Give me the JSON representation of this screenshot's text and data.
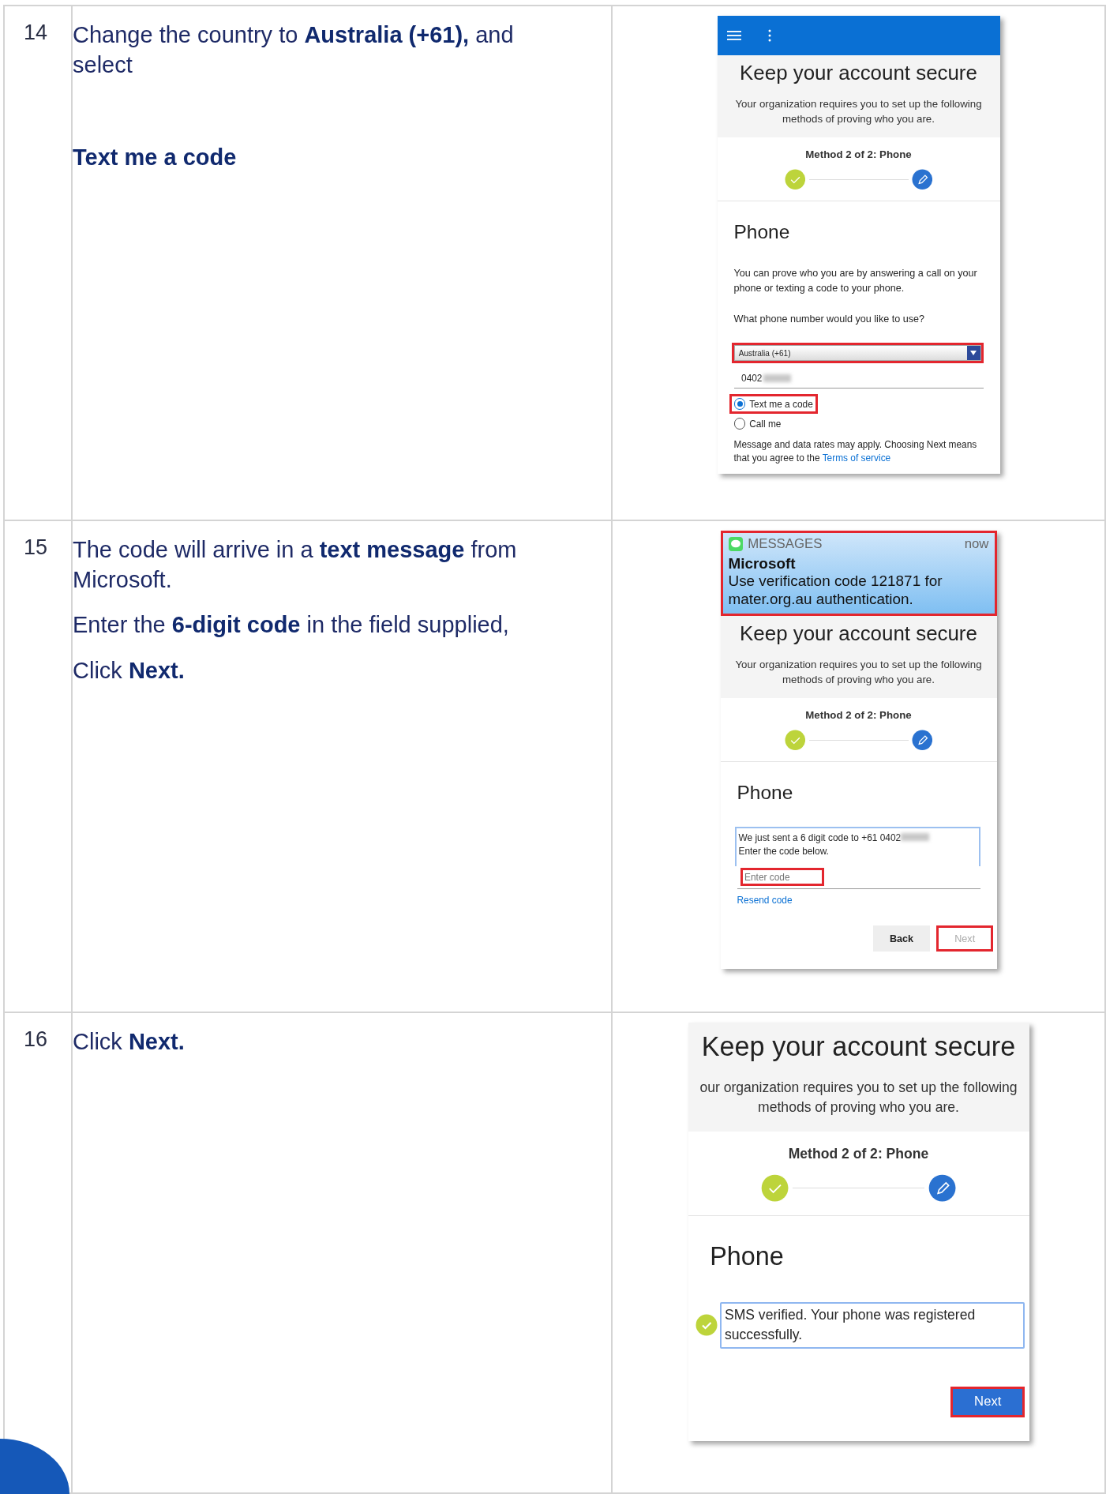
{
  "steps": [
    {
      "number": "14",
      "paragraphs": [
        {
          "kind": "plain",
          "text": "Change the country to **Australia (+61),** and select"
        },
        {
          "kind": "strong",
          "text": "Text me a code"
        }
      ],
      "screen": {
        "top_bar": true,
        "title": "Keep your account secure",
        "subtitle": "Your organization requires you to set up the following methods of proving who you are.",
        "progress_label": "Method 2 of 2: Phone",
        "progress": [
          {
            "completed": true
          },
          {
            "completed": false
          }
        ],
        "heading": "Phone",
        "description": "You can prove who you are by answering a call on your phone or texting a code to your phone.",
        "question": "What phone number would you like to use?",
        "country_select": {
          "value": "Australia (+61)",
          "highlighted": true
        },
        "phone_field": {
          "value": "0402"
        },
        "options": [
          {
            "label": "Text me a code",
            "selected": true,
            "highlighted": true
          },
          {
            "label": "Call me",
            "selected": false,
            "highlighted": false
          }
        ],
        "note": "Message and data rates may apply. Choosing Next means that you agree to the",
        "note_link": "Terms of service"
      }
    },
    {
      "number": "15",
      "paragraphs": [
        {
          "kind": "plain",
          "text": "The code will arrive in a **text message** from Microsoft."
        },
        {
          "kind": "plain",
          "text": "Enter the **6-digit code** in the field supplied,"
        },
        {
          "kind": "plain",
          "text": "Click **Next.**"
        }
      ],
      "screen": {
        "notification": {
          "app": "MESSAGES",
          "time": "now",
          "sender": "Microsoft",
          "body": "Use verification code 121871 for mater.org.au authentication.",
          "highlighted": true
        },
        "title": "Keep your account secure",
        "subtitle": "Your organization requires you to set up the following methods of proving who you are.",
        "progress_label": "Method 2 of 2: Phone",
        "progress": [
          {
            "completed": true
          },
          {
            "completed": false
          }
        ],
        "heading": "Phone",
        "sent_message": "We just sent a 6 digit code to +61 0402",
        "sent_message_2": "Enter the code below.",
        "code_field": {
          "placeholder": "Enter code",
          "highlighted": true
        },
        "resend_link": "Resend code",
        "buttons": [
          {
            "label": "Back",
            "kind": "secondary",
            "disabled": false,
            "highlighted": false
          },
          {
            "label": "Next",
            "kind": "primary",
            "disabled": true,
            "highlighted": true
          }
        ]
      }
    },
    {
      "number": "16",
      "paragraphs": [
        {
          "kind": "plain",
          "text": "Click **Next.**"
        }
      ],
      "screen": {
        "title": "Keep your account secure",
        "subtitle": "our organization requires you to set up the following methods of proving who you are.",
        "progress_label": "Method 2 of 2: Phone",
        "progress": [
          {
            "completed": true
          },
          {
            "completed": false
          }
        ],
        "heading": "Phone",
        "success_message": "SMS verified. Your phone was registered successfully.",
        "buttons": [
          {
            "label": "Next",
            "kind": "primary",
            "disabled": false,
            "highlighted": true
          }
        ]
      }
    }
  ]
}
